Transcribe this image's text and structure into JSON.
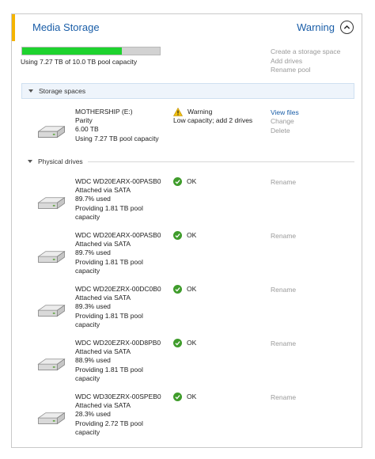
{
  "header": {
    "title": "Media Storage",
    "status": "Warning"
  },
  "pool": {
    "capacity_text": "Using 7.27 TB of 10.0 TB pool capacity",
    "used_fraction": 0.727,
    "actions": [
      "Create a storage space",
      "Add drives",
      "Rename pool"
    ]
  },
  "colors": {
    "accent": "#1a5ea8",
    "warning": "#f5b400",
    "bar_fill": "#1ed32e",
    "ok": "#3f9c2b"
  },
  "storage_spaces": {
    "label": "Storage spaces",
    "items": [
      {
        "icon": "hard-drive-icon",
        "name": "MOTHERSHIP (E:)",
        "resiliency": "Parity",
        "size": "6.00 TB",
        "usage": "Using 7.27 TB pool capacity",
        "status": "Warning",
        "status_detail": "Low capacity; add 2 drives",
        "status_icon": "warning-icon",
        "actions": {
          "view": "View files",
          "change": "Change",
          "delete": "Delete"
        }
      }
    ]
  },
  "physical_drives": {
    "label": "Physical drives",
    "items": [
      {
        "icon": "hard-drive-icon",
        "name": "WDC WD20EARX-00PASB0",
        "connection": "Attached via SATA",
        "used": "89.7% used",
        "providing_line1": "Providing 1.81 TB pool",
        "providing_line2": "capacity",
        "status": "OK",
        "status_icon": "ok-icon",
        "rename": "Rename"
      },
      {
        "icon": "hard-drive-icon",
        "name": "WDC WD20EARX-00PASB0",
        "connection": "Attached via SATA",
        "used": "89.7% used",
        "providing_line1": "Providing 1.81 TB pool",
        "providing_line2": "capacity",
        "status": "OK",
        "status_icon": "ok-icon",
        "rename": "Rename"
      },
      {
        "icon": "hard-drive-icon",
        "name": "WDC WD20EZRX-00DC0B0",
        "connection": "Attached via SATA",
        "used": "89.3% used",
        "providing_line1": "Providing 1.81 TB pool",
        "providing_line2": "capacity",
        "status": "OK",
        "status_icon": "ok-icon",
        "rename": "Rename"
      },
      {
        "icon": "hard-drive-icon",
        "name": "WDC WD20EZRX-00D8PB0",
        "connection": "Attached via SATA",
        "used": "88.9% used",
        "providing_line1": "Providing 1.81 TB pool",
        "providing_line2": "capacity",
        "status": "OK",
        "status_icon": "ok-icon",
        "rename": "Rename"
      },
      {
        "icon": "hard-drive-icon",
        "name": "WDC WD30EZRX-00SPEB0",
        "connection": "Attached via SATA",
        "used": "28.3% used",
        "providing_line1": "Providing 2.72 TB pool",
        "providing_line2": "capacity",
        "status": "OK",
        "status_icon": "ok-icon",
        "rename": "Rename"
      }
    ]
  }
}
